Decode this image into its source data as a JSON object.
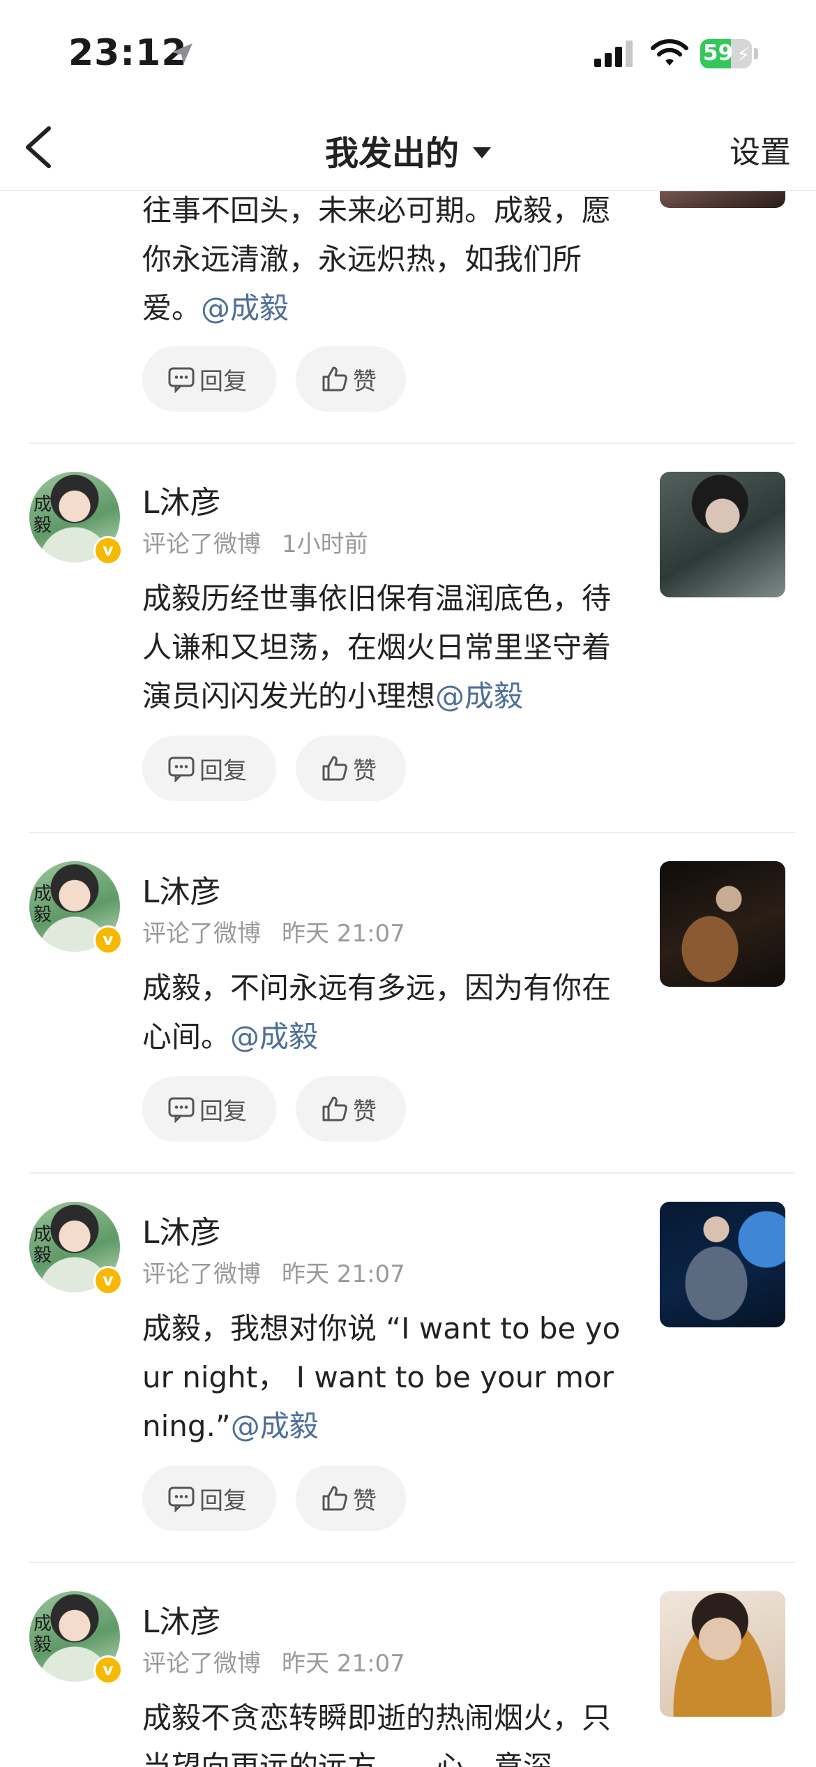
{
  "status_bar": {
    "time": "23:12",
    "battery": "59",
    "battery_level": 59
  },
  "nav": {
    "title": "我发出的",
    "settings": "设置"
  },
  "buttons": {
    "reply": "回复",
    "like": "赞"
  },
  "avatar_glyph": "成 毅",
  "top_partial": {
    "text": "往事不回头，未来必可期。成毅，愿你永远清澈，永远炽热，如我们所爱。",
    "mention": "@成毅"
  },
  "comments": [
    {
      "username": "L沐彦",
      "action": "评论了微博",
      "time": "1小时前",
      "text": "成毅历经世事依旧保有温润底色，待人谦和又坦荡，在烟火日常里坚守着演员闪闪发光的小理想",
      "mention": "@成毅"
    },
    {
      "username": "L沐彦",
      "action": "评论了微博",
      "time": "昨天 21:07",
      "text": "成毅，不问永远有多远，因为有你在心间。",
      "mention": "@成毅"
    },
    {
      "username": "L沐彦",
      "action": "评论了微博",
      "time": "昨天 21:07",
      "text": "成毅，我想对你说 “I want to be your night， I want to be your morning.”",
      "mention": "@成毅"
    },
    {
      "username": "L沐彦",
      "action": "评论了微博",
      "time": "昨天 21:07",
      "text": "成毅不贪恋转瞬即逝的热闹烟火，只当望向更远的远方……心，意深",
      "mention": ""
    }
  ]
}
